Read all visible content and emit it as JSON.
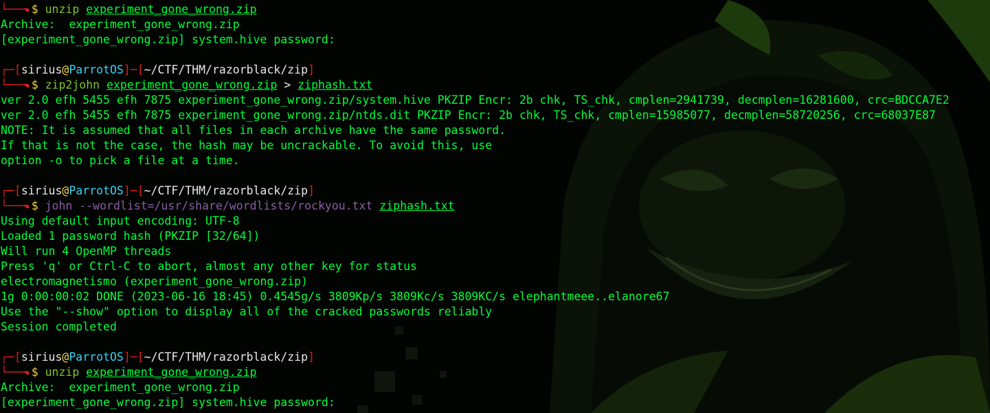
{
  "prompt": {
    "user": "sirius",
    "at": "@",
    "host": "ParrotOS",
    "path": "~/CTF/THM/razorblack/zip",
    "dollar": "$",
    "top_prefix": "┌─[",
    "sep": "]─[",
    "close": "]",
    "bottom_prefix": "└──╼"
  },
  "blocks": [
    {
      "show_header": false,
      "command": "unzip",
      "args": [
        {
          "text": "experiment_gone_wrong.zip",
          "type": "arg"
        }
      ],
      "output": [
        "Archive:  experiment_gone_wrong.zip",
        "[experiment_gone_wrong.zip] system.hive password: "
      ]
    },
    {
      "show_header": true,
      "command": "zip2john",
      "args": [
        {
          "text": "experiment_gone_wrong.zip",
          "type": "arg"
        },
        {
          "text": ">",
          "type": "op"
        },
        {
          "text": "ziphash.txt",
          "type": "arg"
        }
      ],
      "output": [
        "ver 2.0 efh 5455 efh 7875 experiment_gone_wrong.zip/system.hive PKZIP Encr: 2b chk, TS_chk, cmplen=2941739, decmplen=16281600, crc=BDCCA7E2",
        "ver 2.0 efh 5455 efh 7875 experiment_gone_wrong.zip/ntds.dit PKZIP Encr: 2b chk, TS_chk, cmplen=15985077, decmplen=58720256, crc=68037E87",
        "NOTE: It is assumed that all files in each archive have the same password.",
        "If that is not the case, the hash may be uncrackable. To avoid this, use",
        "option -o to pick a file at a time."
      ]
    },
    {
      "show_header": true,
      "command": "john --wordlist=/usr/share/wordlists/rockyou.txt",
      "command_style": "purple",
      "args": [
        {
          "text": "ziphash.txt",
          "type": "arg"
        }
      ],
      "output": [
        "Using default input encoding: UTF-8",
        "Loaded 1 password hash (PKZIP [32/64])",
        "Will run 4 OpenMP threads",
        "Press 'q' or Ctrl-C to abort, almost any other key for status",
        "electromagnetismo (experiment_gone_wrong.zip)",
        "1g 0:00:00:02 DONE (2023-06-16 18:45) 0.4545g/s 3809Kp/s 3809Kc/s 3809KC/s elephantmeee..elanore67",
        "Use the \"--show\" option to display all of the cracked passwords reliably",
        "Session completed"
      ]
    },
    {
      "show_header": true,
      "command": "unzip",
      "args": [
        {
          "text": "experiment_gone_wrong.zip",
          "type": "arg"
        }
      ],
      "output": [
        "Archive:  experiment_gone_wrong.zip",
        "[experiment_gone_wrong.zip] system.hive password: "
      ]
    }
  ],
  "colors": {
    "background": "#020402",
    "output_green": "#00ff3a",
    "prompt_red": "#e51b1b",
    "host_cyan": "#34d3f5",
    "at_yellow": "#f5d142",
    "command_green": "#7cc12e",
    "command_purple": "#8a5ca6"
  },
  "wallpaper": {
    "subject": "hooded-grinning-figure",
    "tint": "#1a2a0a"
  }
}
